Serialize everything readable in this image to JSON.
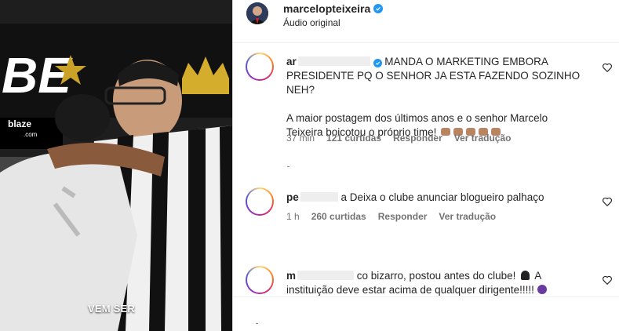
{
  "video": {
    "caption": "VEM SER",
    "badge": "blaze",
    "badge_sub": ".com",
    "letters": "BE"
  },
  "header": {
    "username": "marcelopteixeira",
    "audio": "Áudio original"
  },
  "comments": [
    {
      "user": "ar",
      "text_line1": "MANDA O MARKETING EMBORA",
      "text_line2": "PRESIDENTE PQ O SENHOR JA ESTA FAZENDO SOZINHO NEH?",
      "text_line3": "A maior postagem dos últimos anos e o senhor Marcelo",
      "text_line4": "Teixeira boicotou o próprio time!",
      "time": "37 min",
      "likes": "121 curtidas",
      "reply": "Responder",
      "translate": "Ver tradução"
    },
    {
      "user": "pe",
      "text_line1": "a Deixa o clube anunciar blogueiro palhaço",
      "time": "1 h",
      "likes": "260 curtidas",
      "reply": "Responder",
      "translate": "Ver tradução"
    },
    {
      "user": "m",
      "text_line1": "co bizarro, postou antes do clube!",
      "text_line1b": "A",
      "text_line2": "instituição deve estar acima de qualquer dirigente!!!!!"
    }
  ],
  "colors": {
    "verified": "#1f97f4",
    "muted": "#737373",
    "text": "#262626"
  }
}
